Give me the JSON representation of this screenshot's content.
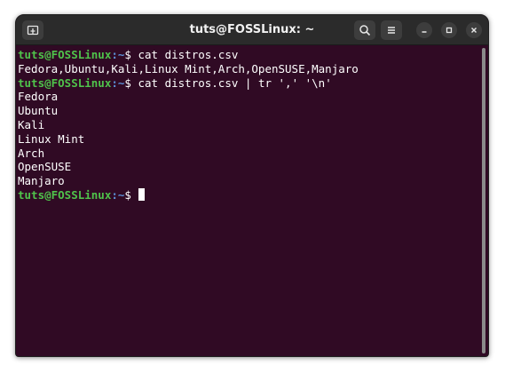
{
  "window": {
    "title": "tuts@FOSSLinux: ~"
  },
  "titlebar": {
    "icons": {
      "new_tab": "new-tab-icon",
      "search": "search-icon",
      "menu": "hamburger-menu-icon",
      "minimize": "minimize-icon",
      "maximize": "maximize-icon",
      "close": "close-icon"
    }
  },
  "terminal": {
    "prompt_user": "tuts@FOSSLinux",
    "prompt_path": ":~",
    "prompt_symbol": "$ ",
    "commands": [
      "cat distros.csv",
      "cat distros.csv | tr ',' '\\n'"
    ],
    "output_csv": "Fedora,Ubuntu,Kali,Linux Mint,Arch,OpenSUSE,Manjaro",
    "output_lines": [
      "Fedora",
      "Ubuntu",
      "Kali",
      "Linux Mint",
      "Arch",
      "OpenSUSE",
      "Manjaro"
    ]
  },
  "colors": {
    "background": "#300a24",
    "titlebar": "#2b2b2b",
    "prompt_user": "#4fc34b",
    "prompt_path": "#5b8fd6",
    "text": "#ffffff"
  }
}
